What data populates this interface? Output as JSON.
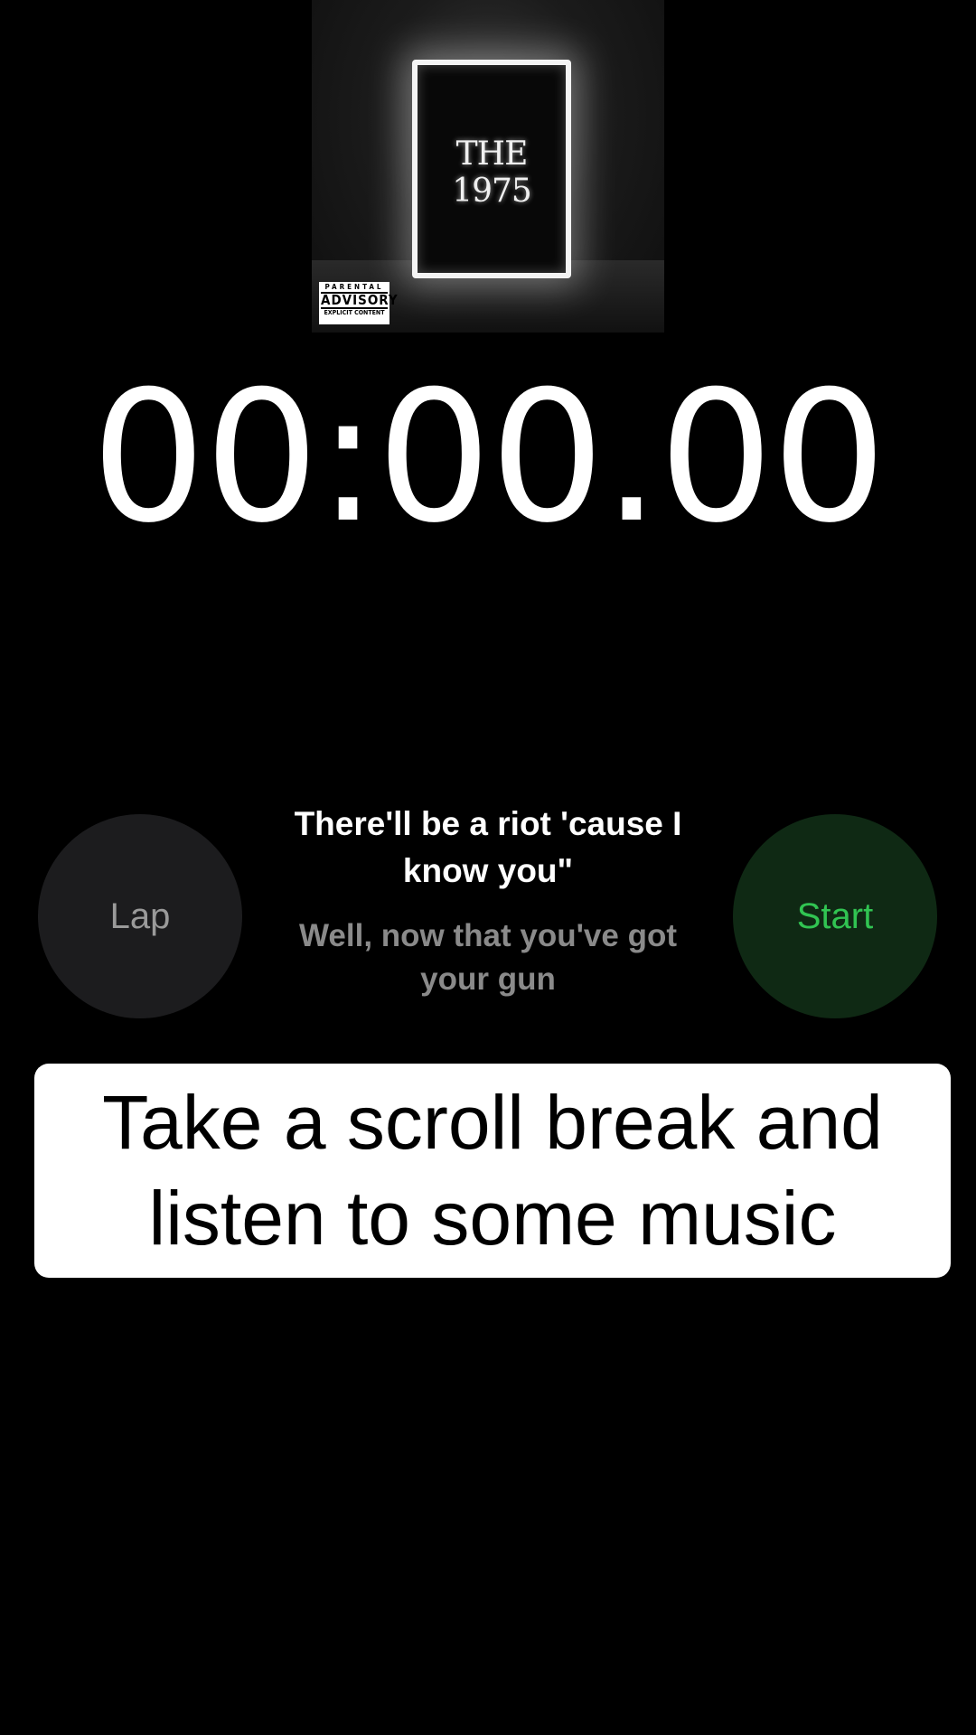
{
  "album": {
    "logo_text": "THE 1975",
    "advisory": {
      "top": "PARENTAL",
      "middle": "ADVISORY",
      "bottom": "EXPLICIT CONTENT"
    }
  },
  "stopwatch": {
    "time": "00:00.00",
    "lap_label": "Lap",
    "start_label": "Start"
  },
  "lyrics": {
    "current": "There'll be a riot 'cause I know you\"",
    "next": "Well, now that you've got your gun"
  },
  "caption": {
    "text": "Take a scroll break and\nlisten to some music"
  },
  "colors": {
    "background": "#000000",
    "start_text": "#31c452",
    "start_bg": "#0f2914",
    "lap_bg": "#1c1c1e",
    "lap_text": "#9a9a9a"
  }
}
